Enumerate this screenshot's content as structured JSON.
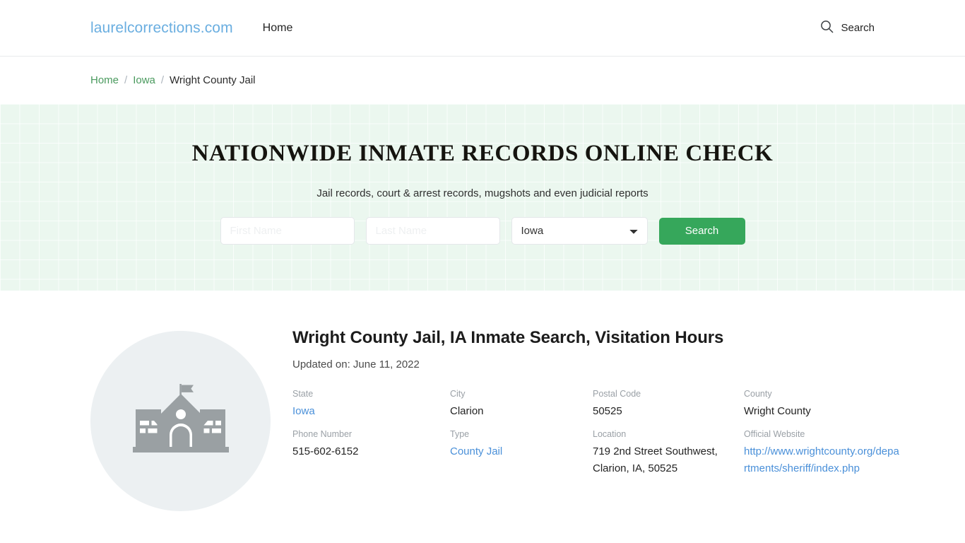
{
  "header": {
    "brand": "laurelcorrections.com",
    "nav": [
      {
        "label": "Home"
      }
    ],
    "search_label": "Search",
    "search_icon": "search-icon"
  },
  "breadcrumb": {
    "items": [
      {
        "label": "Home",
        "type": "link"
      },
      {
        "label": "Iowa",
        "type": "link"
      },
      {
        "label": "Wright County Jail",
        "type": "current"
      }
    ],
    "separator": "/"
  },
  "hero": {
    "title": "NATIONWIDE INMATE RECORDS ONLINE CHECK",
    "subtitle": "Jail records, court & arrest records, mugshots and even judicial reports",
    "form": {
      "first_name_placeholder": "First Name",
      "first_name_value": "",
      "last_name_placeholder": "Last Name",
      "last_name_value": "",
      "state_selected": "Iowa",
      "state_options": [
        "Iowa"
      ],
      "submit_label": "Search"
    },
    "background_color": "#ebf7ef",
    "accent_color": "#36a75b"
  },
  "main": {
    "thumbnail_icon": "courthouse-building-icon",
    "title": "Wright County Jail, IA Inmate Search, Visitation Hours",
    "updated": "Updated on: June 11, 2022",
    "facts": [
      {
        "label": "State",
        "value": "Iowa",
        "is_link": true
      },
      {
        "label": "City",
        "value": "Clarion",
        "is_link": false
      },
      {
        "label": "Postal Code",
        "value": "50525",
        "is_link": false
      },
      {
        "label": "County",
        "value": "Wright County",
        "is_link": false
      },
      {
        "label": "Phone Number",
        "value": "515-602-6152",
        "is_link": false
      },
      {
        "label": "Type",
        "value": "County Jail",
        "is_link": true
      },
      {
        "label": "Location",
        "value": "719 2nd Street Southwest, Clarion, IA, 50525",
        "is_link": false
      },
      {
        "label": "Official Website",
        "value": "http://www.wrightcounty.org/departments/sheriff/index.php",
        "is_link": true
      }
    ]
  }
}
